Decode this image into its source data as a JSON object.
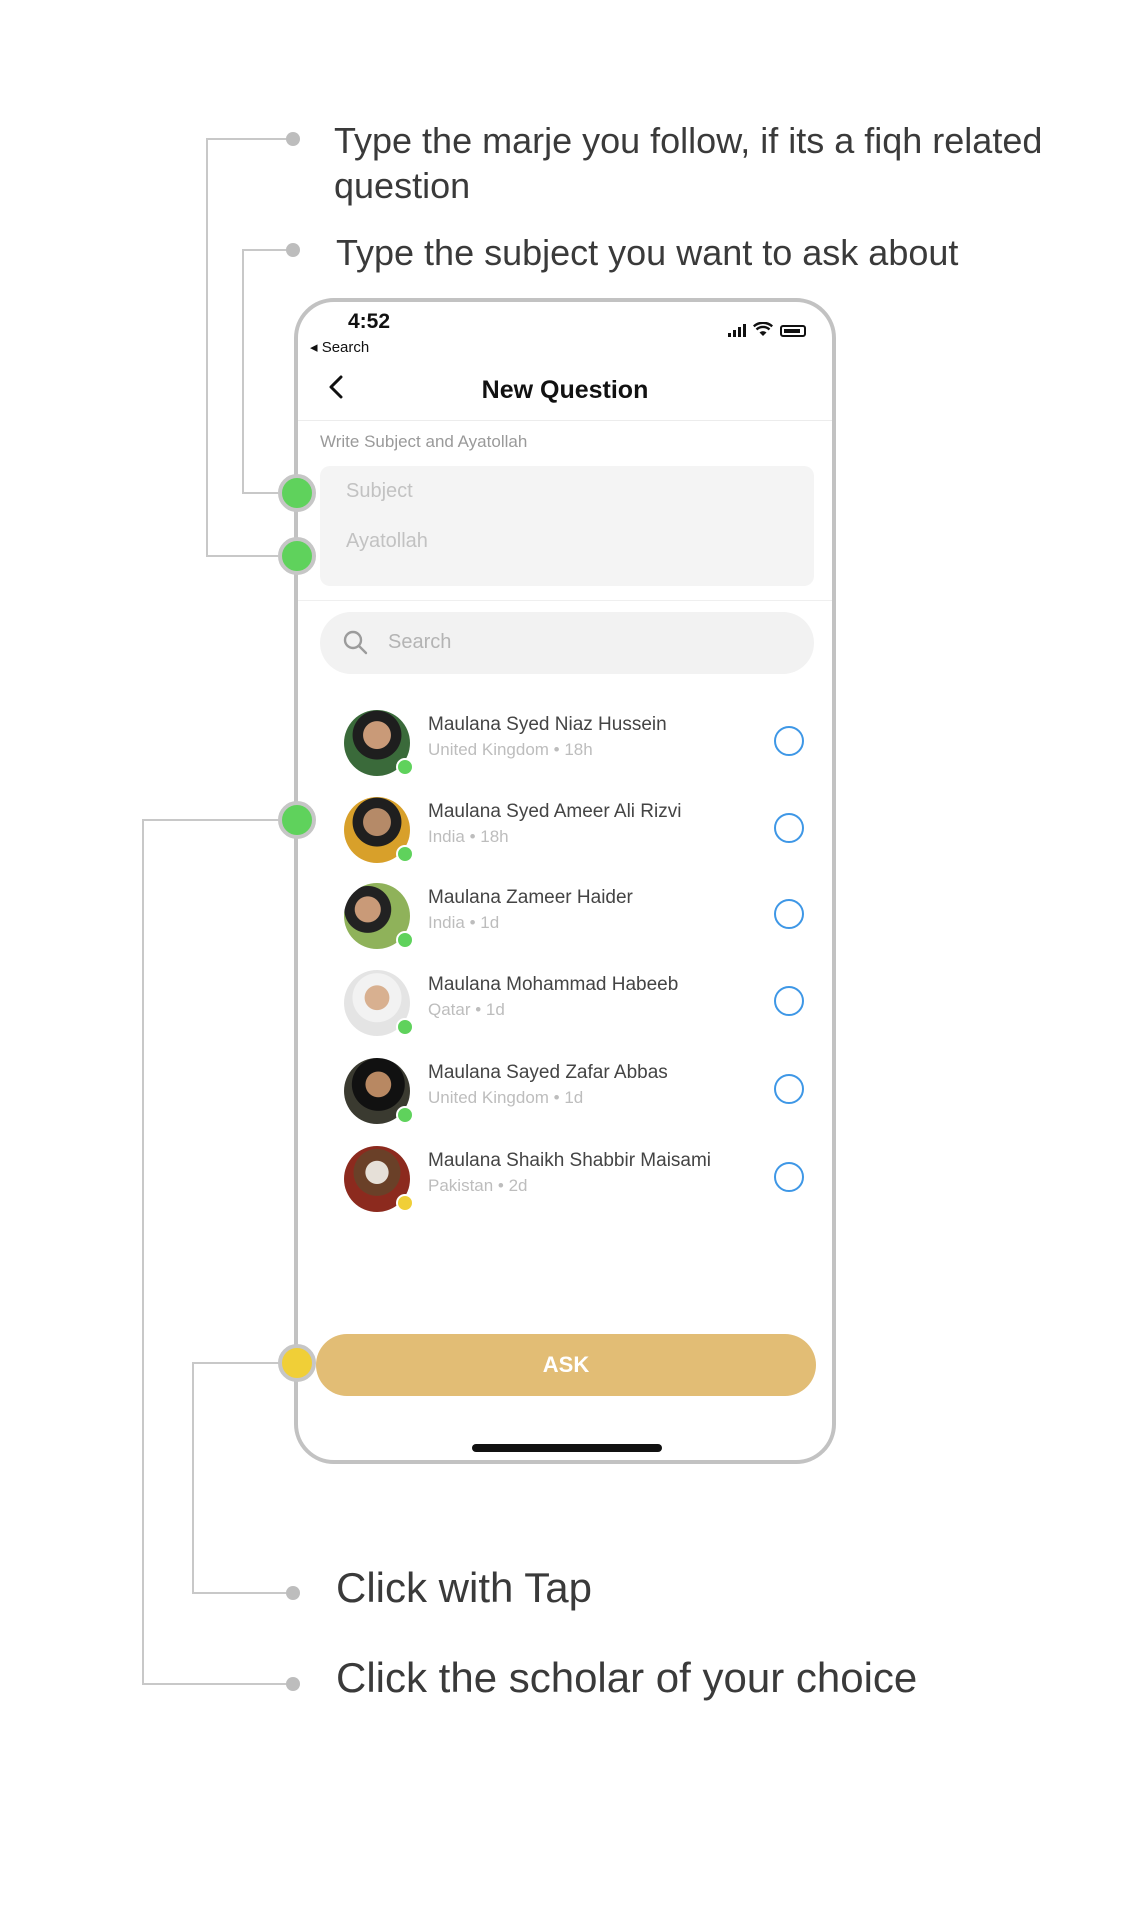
{
  "annotations": {
    "marje_hint": "Type the marje you follow, if its a fiqh related question",
    "subject_hint": "Type the subject you want to ask about",
    "tap_hint": "Click with Tap",
    "scholar_hint": "Click the scholar of your choice"
  },
  "status_bar": {
    "time": "4:52",
    "back_label": "◂ Search"
  },
  "nav": {
    "title": "New Question"
  },
  "form": {
    "section_label": "Write Subject and Ayatollah",
    "subject_placeholder": "Subject",
    "ayatollah_placeholder": "Ayatollah"
  },
  "search": {
    "placeholder": "Search"
  },
  "scholars": [
    {
      "name": "Maulana Syed Niaz Hussein",
      "meta": "United Kingdom • 18h",
      "status": "online"
    },
    {
      "name": "Maulana Syed Ameer Ali Rizvi",
      "meta": "India • 18h",
      "status": "online"
    },
    {
      "name": "Maulana Zameer Haider",
      "meta": "India • 1d",
      "status": "online"
    },
    {
      "name": "Maulana Mohammad Habeeb",
      "meta": "Qatar • 1d",
      "status": "online"
    },
    {
      "name": "Maulana Sayed Zafar Abbas",
      "meta": "United Kingdom • 1d",
      "status": "online"
    },
    {
      "name": "Maulana Shaikh Shabbir Maisami",
      "meta": "Pakistan • 2d",
      "status": "away"
    }
  ],
  "ask_button": {
    "label": "ASK"
  },
  "colors": {
    "ask": "#e2bd75",
    "online": "#5fd25c",
    "away": "#f0cf37",
    "radio": "#3e97e6"
  }
}
